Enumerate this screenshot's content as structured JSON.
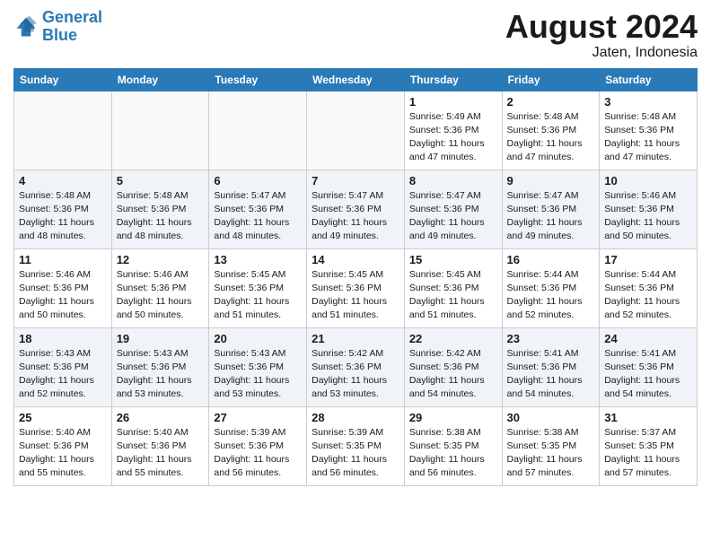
{
  "header": {
    "logo_line1": "General",
    "logo_line2": "Blue",
    "month": "August 2024",
    "location": "Jaten, Indonesia"
  },
  "weekdays": [
    "Sunday",
    "Monday",
    "Tuesday",
    "Wednesday",
    "Thursday",
    "Friday",
    "Saturday"
  ],
  "weeks": [
    [
      {
        "day": "",
        "info": ""
      },
      {
        "day": "",
        "info": ""
      },
      {
        "day": "",
        "info": ""
      },
      {
        "day": "",
        "info": ""
      },
      {
        "day": "1",
        "info": "Sunrise: 5:49 AM\nSunset: 5:36 PM\nDaylight: 11 hours\nand 47 minutes."
      },
      {
        "day": "2",
        "info": "Sunrise: 5:48 AM\nSunset: 5:36 PM\nDaylight: 11 hours\nand 47 minutes."
      },
      {
        "day": "3",
        "info": "Sunrise: 5:48 AM\nSunset: 5:36 PM\nDaylight: 11 hours\nand 47 minutes."
      }
    ],
    [
      {
        "day": "4",
        "info": "Sunrise: 5:48 AM\nSunset: 5:36 PM\nDaylight: 11 hours\nand 48 minutes."
      },
      {
        "day": "5",
        "info": "Sunrise: 5:48 AM\nSunset: 5:36 PM\nDaylight: 11 hours\nand 48 minutes."
      },
      {
        "day": "6",
        "info": "Sunrise: 5:47 AM\nSunset: 5:36 PM\nDaylight: 11 hours\nand 48 minutes."
      },
      {
        "day": "7",
        "info": "Sunrise: 5:47 AM\nSunset: 5:36 PM\nDaylight: 11 hours\nand 49 minutes."
      },
      {
        "day": "8",
        "info": "Sunrise: 5:47 AM\nSunset: 5:36 PM\nDaylight: 11 hours\nand 49 minutes."
      },
      {
        "day": "9",
        "info": "Sunrise: 5:47 AM\nSunset: 5:36 PM\nDaylight: 11 hours\nand 49 minutes."
      },
      {
        "day": "10",
        "info": "Sunrise: 5:46 AM\nSunset: 5:36 PM\nDaylight: 11 hours\nand 50 minutes."
      }
    ],
    [
      {
        "day": "11",
        "info": "Sunrise: 5:46 AM\nSunset: 5:36 PM\nDaylight: 11 hours\nand 50 minutes."
      },
      {
        "day": "12",
        "info": "Sunrise: 5:46 AM\nSunset: 5:36 PM\nDaylight: 11 hours\nand 50 minutes."
      },
      {
        "day": "13",
        "info": "Sunrise: 5:45 AM\nSunset: 5:36 PM\nDaylight: 11 hours\nand 51 minutes."
      },
      {
        "day": "14",
        "info": "Sunrise: 5:45 AM\nSunset: 5:36 PM\nDaylight: 11 hours\nand 51 minutes."
      },
      {
        "day": "15",
        "info": "Sunrise: 5:45 AM\nSunset: 5:36 PM\nDaylight: 11 hours\nand 51 minutes."
      },
      {
        "day": "16",
        "info": "Sunrise: 5:44 AM\nSunset: 5:36 PM\nDaylight: 11 hours\nand 52 minutes."
      },
      {
        "day": "17",
        "info": "Sunrise: 5:44 AM\nSunset: 5:36 PM\nDaylight: 11 hours\nand 52 minutes."
      }
    ],
    [
      {
        "day": "18",
        "info": "Sunrise: 5:43 AM\nSunset: 5:36 PM\nDaylight: 11 hours\nand 52 minutes."
      },
      {
        "day": "19",
        "info": "Sunrise: 5:43 AM\nSunset: 5:36 PM\nDaylight: 11 hours\nand 53 minutes."
      },
      {
        "day": "20",
        "info": "Sunrise: 5:43 AM\nSunset: 5:36 PM\nDaylight: 11 hours\nand 53 minutes."
      },
      {
        "day": "21",
        "info": "Sunrise: 5:42 AM\nSunset: 5:36 PM\nDaylight: 11 hours\nand 53 minutes."
      },
      {
        "day": "22",
        "info": "Sunrise: 5:42 AM\nSunset: 5:36 PM\nDaylight: 11 hours\nand 54 minutes."
      },
      {
        "day": "23",
        "info": "Sunrise: 5:41 AM\nSunset: 5:36 PM\nDaylight: 11 hours\nand 54 minutes."
      },
      {
        "day": "24",
        "info": "Sunrise: 5:41 AM\nSunset: 5:36 PM\nDaylight: 11 hours\nand 54 minutes."
      }
    ],
    [
      {
        "day": "25",
        "info": "Sunrise: 5:40 AM\nSunset: 5:36 PM\nDaylight: 11 hours\nand 55 minutes."
      },
      {
        "day": "26",
        "info": "Sunrise: 5:40 AM\nSunset: 5:36 PM\nDaylight: 11 hours\nand 55 minutes."
      },
      {
        "day": "27",
        "info": "Sunrise: 5:39 AM\nSunset: 5:36 PM\nDaylight: 11 hours\nand 56 minutes."
      },
      {
        "day": "28",
        "info": "Sunrise: 5:39 AM\nSunset: 5:35 PM\nDaylight: 11 hours\nand 56 minutes."
      },
      {
        "day": "29",
        "info": "Sunrise: 5:38 AM\nSunset: 5:35 PM\nDaylight: 11 hours\nand 56 minutes."
      },
      {
        "day": "30",
        "info": "Sunrise: 5:38 AM\nSunset: 5:35 PM\nDaylight: 11 hours\nand 57 minutes."
      },
      {
        "day": "31",
        "info": "Sunrise: 5:37 AM\nSunset: 5:35 PM\nDaylight: 11 hours\nand 57 minutes."
      }
    ]
  ]
}
